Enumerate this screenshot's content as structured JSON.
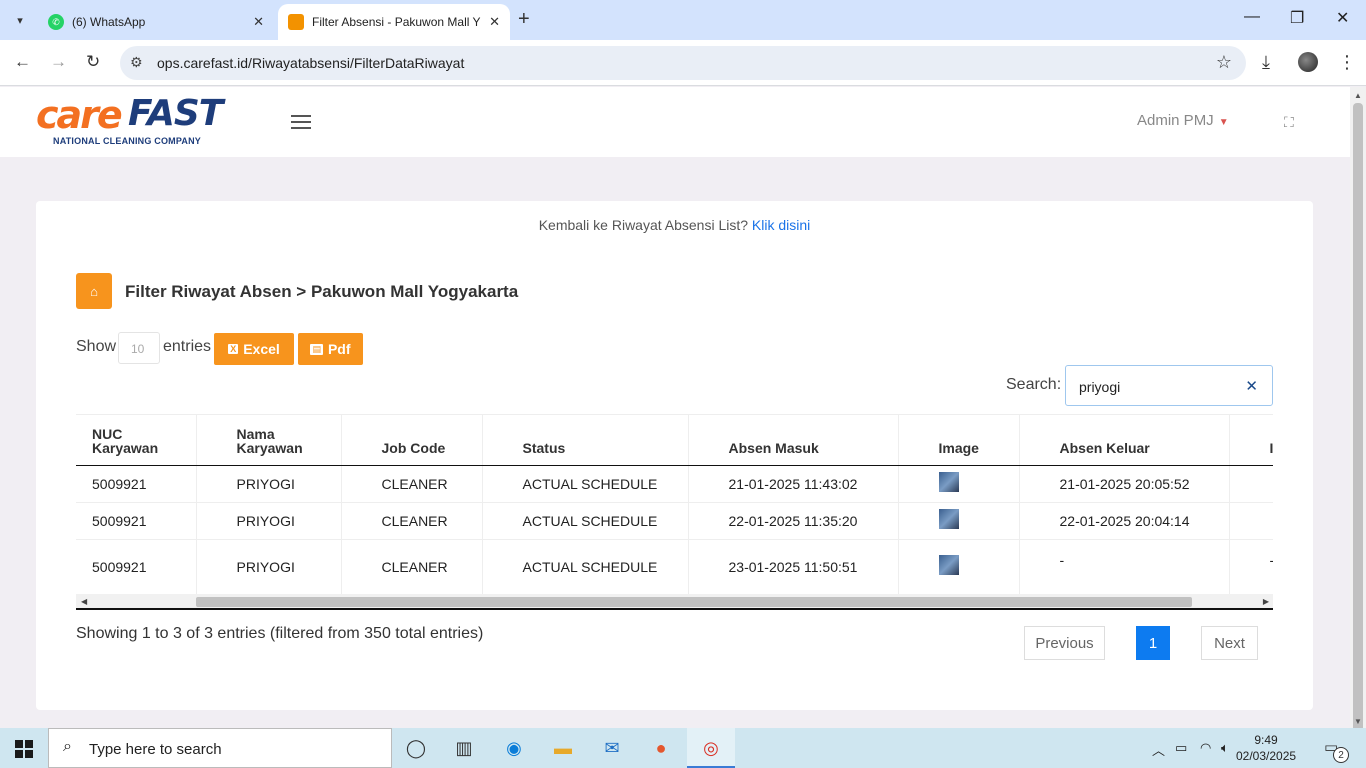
{
  "browser": {
    "tabs": [
      {
        "title": "(6) WhatsApp",
        "active": false
      },
      {
        "title": "Filter Absensi - Pakuwon Mall Y",
        "active": true
      }
    ],
    "url": "ops.carefast.id/Riwayatabsensi/FilterDataRiwayat"
  },
  "header": {
    "logo_care": "care",
    "logo_fast": "FAST",
    "logo_tagline": "NATIONAL CLEANING COMPANY",
    "user": "Admin PMJ"
  },
  "page": {
    "back_text": "Kembali ke Riwayat Absensi List?",
    "back_link": "Klik disini",
    "title": "Filter Riwayat Absen > Pakuwon Mall Yogyakarta",
    "show_label": "Show",
    "length_value": "10",
    "entries_label": "entries",
    "excel_label": "Excel",
    "pdf_label": "Pdf",
    "search_label": "Search:",
    "search_value": "priyogi",
    "info": "Showing 1 to 3 of 3 entries (filtered from 350 total entries)",
    "previous": "Previous",
    "current_page": "1",
    "next": "Next"
  },
  "table": {
    "headers": [
      "NUC Karyawan",
      "Nama Karyawan",
      "Job Code",
      "Status",
      "Absen Masuk",
      "Image",
      "Absen Keluar",
      "I"
    ],
    "rows": [
      {
        "nuc": "5009921",
        "nama": "PRIYOGI",
        "job": "CLEANER",
        "status": "ACTUAL SCHEDULE",
        "masuk": "21-01-2025 11:43:02",
        "keluar": "21-01-2025 20:05:52",
        "extra": ""
      },
      {
        "nuc": "5009921",
        "nama": "PRIYOGI",
        "job": "CLEANER",
        "status": "ACTUAL SCHEDULE",
        "masuk": "22-01-2025 11:35:20",
        "keluar": "22-01-2025 20:04:14",
        "extra": ""
      },
      {
        "nuc": "5009921",
        "nama": "PRIYOGI",
        "job": "CLEANER",
        "status": "ACTUAL SCHEDULE",
        "masuk": "23-01-2025 11:50:51",
        "keluar": "-",
        "extra": "-"
      }
    ]
  },
  "taskbar": {
    "search_placeholder": "Type here to search",
    "time": "9:49",
    "date": "02/03/2025",
    "notifications": "2"
  }
}
